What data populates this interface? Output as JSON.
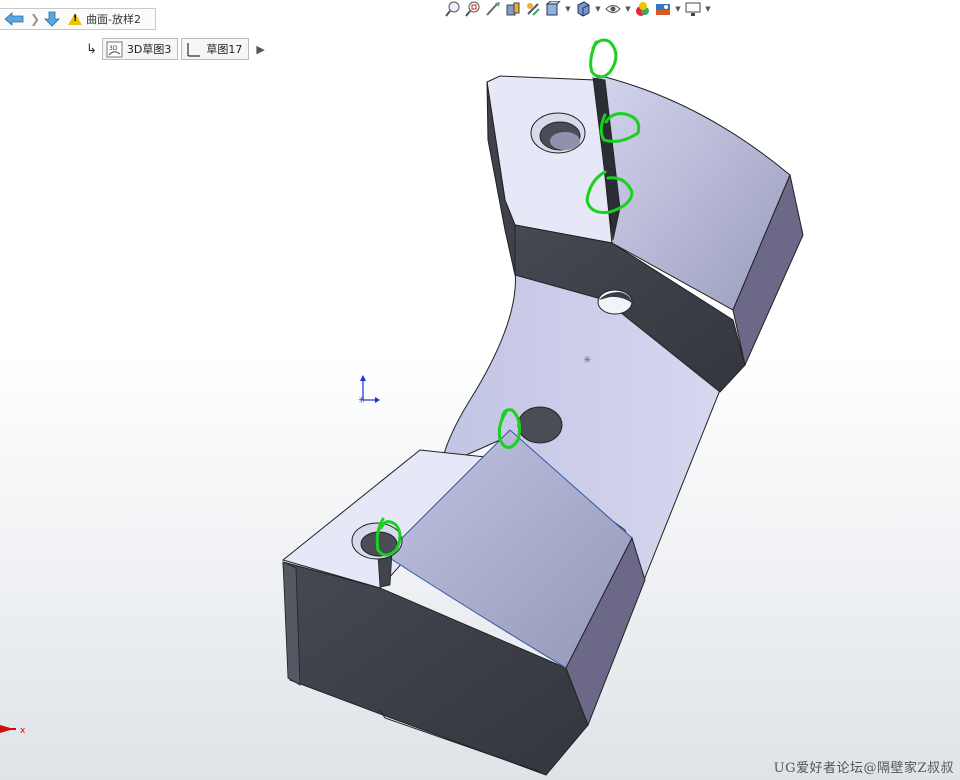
{
  "breadcrumb": {
    "feature_title": "曲面-放样2",
    "icons": [
      "back-arrow-icon",
      "down-arrow-icon",
      "warning-icon"
    ]
  },
  "sketches": [
    {
      "label": "3D草图3",
      "icon": "3d-sketch-icon",
      "icon_text": "3D"
    },
    {
      "label": "草图17",
      "icon": "sketch-icon"
    }
  ],
  "toolbar": {
    "icons": [
      "zoom-to-fit-icon",
      "zoom-to-area-icon",
      "previous-view-icon",
      "section-view-icon",
      "dynamic-annotation-icon",
      "view-orientation-icon",
      "display-style-icon",
      "hide-show-items-icon",
      "edit-appearance-icon",
      "apply-scene-icon",
      "view-settings-icon"
    ]
  },
  "triad": {
    "x_label": "x"
  },
  "watermark": "UG爱好者论坛@隔壁家Z叔叔",
  "colors": {
    "top_face": "#e6e8f8",
    "lofted_face": "#b0b2d0",
    "dark_face": "#41434d",
    "side_face": "#6b6987",
    "annotation_green": "#19d11e",
    "triad_blue": "#1f2fd6",
    "triad_red": "#d01010"
  }
}
